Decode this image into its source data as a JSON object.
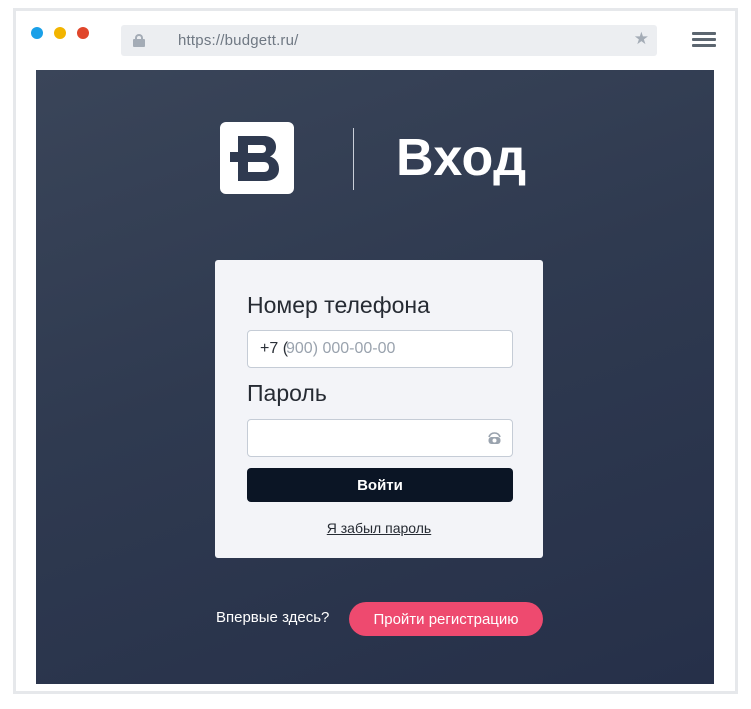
{
  "browser": {
    "url": "https://budgett.ru/",
    "icons": {
      "lock": "lock-icon",
      "star": "star-icon",
      "menu": "hamburger-menu-icon"
    },
    "window_controls": [
      "#1aa0e8",
      "#f2b400",
      "#e0462b"
    ]
  },
  "header": {
    "logo": "budgett-logo",
    "title": "Вход"
  },
  "login_form": {
    "phone_label": "Номер телефона",
    "phone_prefix": "+7 (",
    "phone_placeholder": "900) 000-00-00",
    "password_label": "Пароль",
    "password_value": "",
    "password_toggle_icon": "eye-icon",
    "submit_label": "Войти",
    "forgot_label": "Я забыл пароль"
  },
  "footer": {
    "prompt": "Впервые здесь?",
    "register_label": "Пройти регистрацию"
  },
  "colors": {
    "background": "#2f3a50",
    "card": "#f3f4f8",
    "primary_button": "#0b1525",
    "accent": "#ee4a6f"
  }
}
